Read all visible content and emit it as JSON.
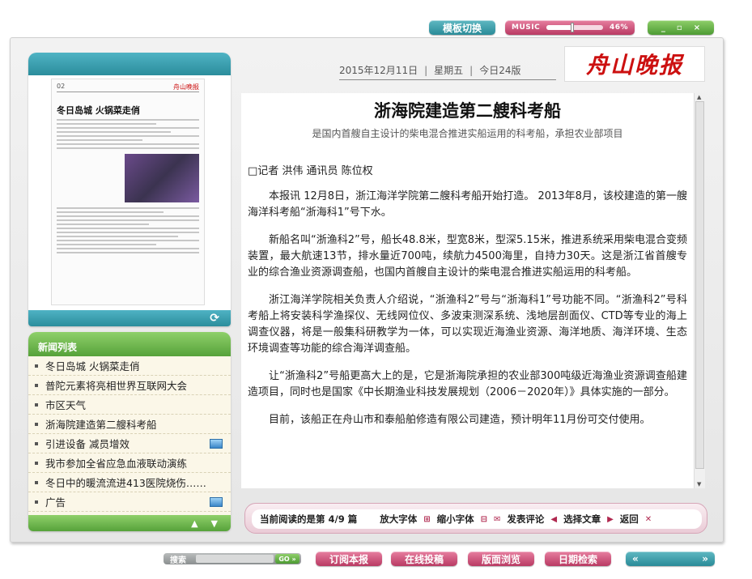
{
  "toolbar": {
    "template_switch": "模板切换",
    "music": {
      "label": "MUSIC",
      "volume_text": "46%",
      "volume": 0.46
    },
    "window_controls": [
      "_",
      "▫",
      "×"
    ]
  },
  "header": {
    "date": "2015年12月11日",
    "weekday": "星期五",
    "pages": "今日24版",
    "logo_text": "舟山晚报"
  },
  "thumbnail": {
    "page_no": "02",
    "headline": "冬日岛城 火锅菜走俏",
    "refresh_icon": "refresh-icon"
  },
  "news": {
    "heading": "新闻列表",
    "items": [
      {
        "label": "冬日岛城 火锅菜走俏",
        "has_media": false
      },
      {
        "label": "普陀元素将亮相世界互联网大会",
        "has_media": false
      },
      {
        "label": "市区天气",
        "has_media": false
      },
      {
        "label": "浙海院建造第二艘科考船",
        "has_media": false
      },
      {
        "label": "引进设备 减员增效",
        "has_media": true
      },
      {
        "label": "我市参加全省应急血液联动演练",
        "has_media": false
      },
      {
        "label": "冬日中的暖流流进413医院烧伤……",
        "has_media": false
      },
      {
        "label": "广告",
        "has_media": true
      }
    ],
    "up_icon": "up-arrow-icon",
    "down_icon": "down-arrow-icon"
  },
  "article": {
    "title": "浙海院建造第二艘科考船",
    "subtitle": "是国内首艘自主设计的柴电混合推进实船运用的科考船，承担农业部项目",
    "byline": "□记者 洪伟 通讯员 陈位权",
    "paragraphs": [
      "本报讯 12月8日，浙江海洋学院第二艘科考船开始打造。 2013年8月，该校建造的第一艘海洋科考船“浙海科1”号下水。",
      "新船名叫“浙渔科2”号，船长48.8米，型宽8米，型深5.15米，推进系统采用柴电混合变频装置，最大航速13节，排水量近700吨，续航力4500海里，自持力30天。这是浙江省首艘专业的综合渔业资源调查船，也国内首艘自主设计的柴电混合推进实船运用的科考船。",
      "浙江海洋学院相关负责人介绍说，“浙渔科2”号与“浙海科1”号功能不同。“浙渔科2”号科考船上将安装科学渔探仪、无线网位仪、多波束测深系统、浅地层剖面仪、CTD等专业的海上调查仪器，将是一般集科研教学为一体，可以实现近海渔业资源、海洋地质、海洋环境、生态环境调查等功能的综合海洋调查船。",
      "让“浙渔科2”号船更高大上的是，它是浙海院承担的农业部300吨级近海渔业资源调查船建造项目，同时也是国家《中长期渔业科技发展规划（2006－2020年）》具体实施的一部分。",
      "目前，该船正在舟山市和泰船舶修造有限公司建造，预计明年11月份可交付使用。"
    ]
  },
  "reader": {
    "progress_text": "当前阅读的是第 4/9 篇",
    "enlarge": "放大字体",
    "shrink": "缩小字体",
    "comment": "发表评论",
    "select": "选择文章",
    "back": "返回"
  },
  "bottom": {
    "search_label": "搜索",
    "go_label": "GO »",
    "subscribe": "订阅本报",
    "submit": "在线投稿",
    "browse": "版面浏览",
    "date_search": "日期检索",
    "prev": "«",
    "next": "»"
  },
  "colors": {
    "teal": "#2a8b98",
    "pink": "#b93a63",
    "green": "#4d9b33",
    "logo_red": "#cc1010"
  }
}
